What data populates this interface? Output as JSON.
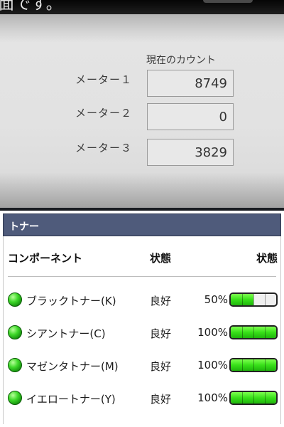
{
  "top_screen": {
    "clipped_title": "面です。",
    "count_header": "現在のカウント",
    "meters": [
      {
        "label": "メーター１",
        "value": "8749"
      },
      {
        "label": "メーター２",
        "value": "0"
      },
      {
        "label": "メーター３",
        "value": "3829"
      }
    ]
  },
  "toner": {
    "title": "トナー",
    "columns": {
      "component": "コンポーネント",
      "status": "状態",
      "level": "状態"
    },
    "items": [
      {
        "name": "ブラックトナー(K)",
        "status": "良好",
        "percent": "50%",
        "level": 0.5,
        "led_color": "#3fd92a"
      },
      {
        "name": "シアントナー(C)",
        "status": "良好",
        "percent": "100%",
        "level": 1.0,
        "led_color": "#3fd92a"
      },
      {
        "name": "マゼンタトナー(M)",
        "status": "良好",
        "percent": "100%",
        "level": 1.0,
        "led_color": "#3fd92a"
      },
      {
        "name": "イエロートナー(Y)",
        "status": "良好",
        "percent": "100%",
        "level": 1.0,
        "led_color": "#3fd92a"
      }
    ],
    "bar_fill_color": "#38e019"
  }
}
